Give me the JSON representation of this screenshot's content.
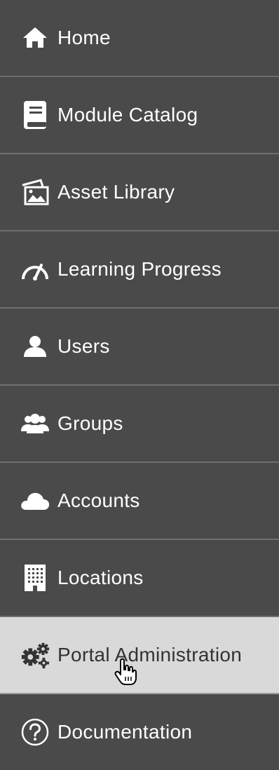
{
  "nav": {
    "items": [
      {
        "label": "Home",
        "icon": "home-icon"
      },
      {
        "label": "Module Catalog",
        "icon": "book-icon"
      },
      {
        "label": "Asset Library",
        "icon": "asset-library-icon"
      },
      {
        "label": "Learning Progress",
        "icon": "gauge-icon"
      },
      {
        "label": "Users",
        "icon": "user-icon"
      },
      {
        "label": "Groups",
        "icon": "group-icon"
      },
      {
        "label": "Accounts",
        "icon": "cloud-icon"
      },
      {
        "label": "Locations",
        "icon": "building-icon"
      },
      {
        "label": "Portal Administration",
        "icon": "gears-icon"
      },
      {
        "label": "Documentation",
        "icon": "question-circle-icon"
      }
    ],
    "active_index": 8
  },
  "colors": {
    "background": "#4a4a4a",
    "divider": "#6f6f6f",
    "active_background": "#d9d9d9",
    "text": "#ffffff",
    "active_text": "#333333"
  }
}
